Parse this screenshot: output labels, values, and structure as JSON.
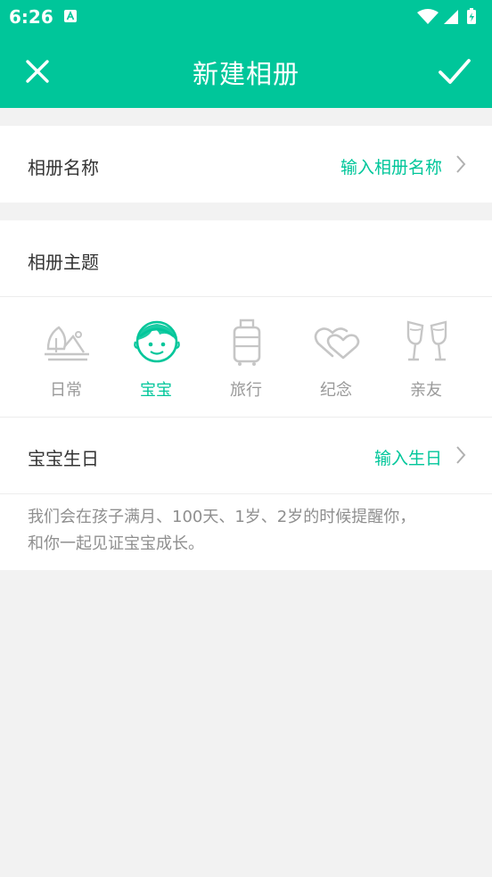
{
  "status_bar": {
    "time": "6:26"
  },
  "toolbar": {
    "title": "新建相册",
    "close_icon": "close-icon",
    "confirm_icon": "check-icon"
  },
  "album_name": {
    "label": "相册名称",
    "value": "输入相册名称"
  },
  "album_theme": {
    "label": "相册主题",
    "options": [
      {
        "label": "日常",
        "icon": "landscape-icon",
        "selected": false
      },
      {
        "label": "宝宝",
        "icon": "baby-face-icon",
        "selected": true
      },
      {
        "label": "旅行",
        "icon": "suitcase-icon",
        "selected": false
      },
      {
        "label": "纪念",
        "icon": "hearts-icon",
        "selected": false
      },
      {
        "label": "亲友",
        "icon": "cheers-glasses-icon",
        "selected": false
      }
    ]
  },
  "baby_birthday": {
    "label": "宝宝生日",
    "value": "输入生日"
  },
  "hint": {
    "line1": "我们会在孩子满月、100天、1岁、2岁的时候提醒你，",
    "line2": "和你一起见证宝宝成长。"
  },
  "colors": {
    "accent": "#00c69a",
    "background": "#f2f2f2",
    "inactive": "#bdbdbd"
  }
}
